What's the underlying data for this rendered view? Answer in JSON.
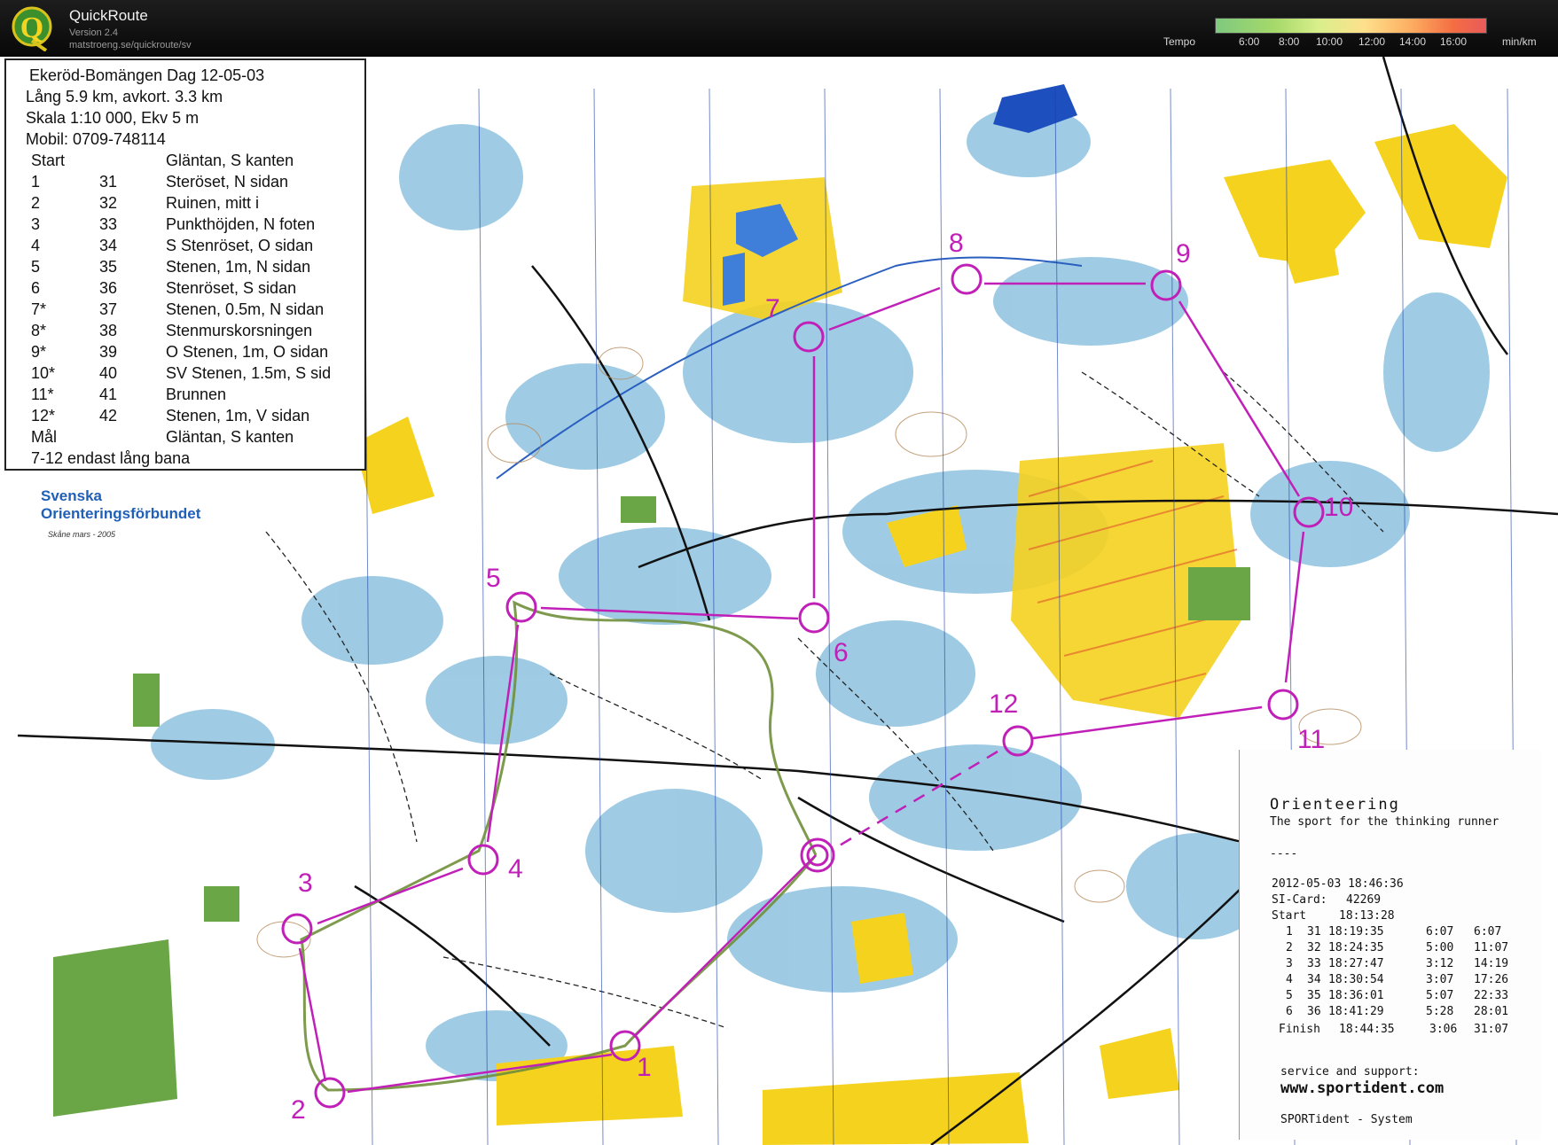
{
  "header": {
    "app_name": "QuickRoute",
    "version": "Version 2.4",
    "url": "matstroeng.se/quickroute/sv",
    "tempo_label": "Tempo",
    "tempo_ticks": [
      "6:00",
      "8:00",
      "10:00",
      "12:00",
      "14:00",
      "16:00"
    ],
    "unit": "min/km"
  },
  "course_info": {
    "title": "Ekeröd-Bomängen Dag 12-05-03",
    "length": "Lång 5.9 km,  avkort. 3.3 km",
    "scale": "Skala 1:10 000, Ekv 5 m",
    "mobile": "Mobil: 0709-748114",
    "start_label": "Start",
    "start_desc": "Gläntan, S kanten",
    "controls": [
      {
        "num": "1",
        "code": "31",
        "desc": "Steröset, N sidan"
      },
      {
        "num": "2",
        "code": "32",
        "desc": "Ruinen, mitt i"
      },
      {
        "num": "3",
        "code": "33",
        "desc": "Punkthöjden, N foten"
      },
      {
        "num": "4",
        "code": "34",
        "desc": "S Stenröset, O sidan"
      },
      {
        "num": "5",
        "code": "35",
        "desc": "Stenen, 1m, N sidan"
      },
      {
        "num": "6",
        "code": "36",
        "desc": "Stenröset, S sidan"
      },
      {
        "num": "7*",
        "code": "37",
        "desc": "Stenen, 0.5m, N sidan"
      },
      {
        "num": "8*",
        "code": "38",
        "desc": "Stenmurskorsningen"
      },
      {
        "num": "9*",
        "code": "39",
        "desc": "O Stenen, 1m, O sidan"
      },
      {
        "num": "10*",
        "code": "40",
        "desc": "SV Stenen, 1.5m, S sid"
      },
      {
        "num": "11*",
        "code": "41",
        "desc": "Brunnen"
      },
      {
        "num": "12*",
        "code": "42",
        "desc": "Stenen, 1m, V sidan"
      }
    ],
    "finish_label": "Mål",
    "finish_desc": "Gläntan, S kanten",
    "note": "7-12 endast lång bana"
  },
  "federation": {
    "line1": "Svenska",
    "line2": "Orienteringsförbundet",
    "sub": "Skåne  mars - 2005"
  },
  "receipt": {
    "title": "Orienteering",
    "slogan": "The sport for the thinking runner",
    "sep": "----",
    "datetime": "2012-05-03  18:46:36",
    "card_label": "SI-Card:",
    "card_value": "42269",
    "start_label": "Start",
    "start_time": "18:13:28",
    "splits": [
      {
        "n": "1",
        "code": "31",
        "time": "18:19:35",
        "split": "6:07",
        "cum": "6:07"
      },
      {
        "n": "2",
        "code": "32",
        "time": "18:24:35",
        "split": "5:00",
        "cum": "11:07"
      },
      {
        "n": "3",
        "code": "33",
        "time": "18:27:47",
        "split": "3:12",
        "cum": "14:19"
      },
      {
        "n": "4",
        "code": "34",
        "time": "18:30:54",
        "split": "3:07",
        "cum": "17:26"
      },
      {
        "n": "5",
        "code": "35",
        "time": "18:36:01",
        "split": "5:07",
        "cum": "22:33"
      },
      {
        "n": "6",
        "code": "36",
        "time": "18:41:29",
        "split": "5:28",
        "cum": "28:01"
      }
    ],
    "finish_label": "Finish",
    "finish_time": "18:44:35",
    "finish_split": "3:06",
    "finish_cum": "31:07",
    "support": "service and support:",
    "website": "www.sportident.com",
    "system": "SPORTident - System"
  },
  "map": {
    "control_labels": [
      "1",
      "2",
      "3",
      "4",
      "5",
      "6",
      "7",
      "8",
      "9",
      "10",
      "11",
      "12"
    ],
    "colors": {
      "course": "#c020b8",
      "route": "#6f8f3a",
      "open": "#f5d21e",
      "marsh": "#8ec3df",
      "forest": "#ffffff",
      "green": "#6aa646"
    }
  }
}
